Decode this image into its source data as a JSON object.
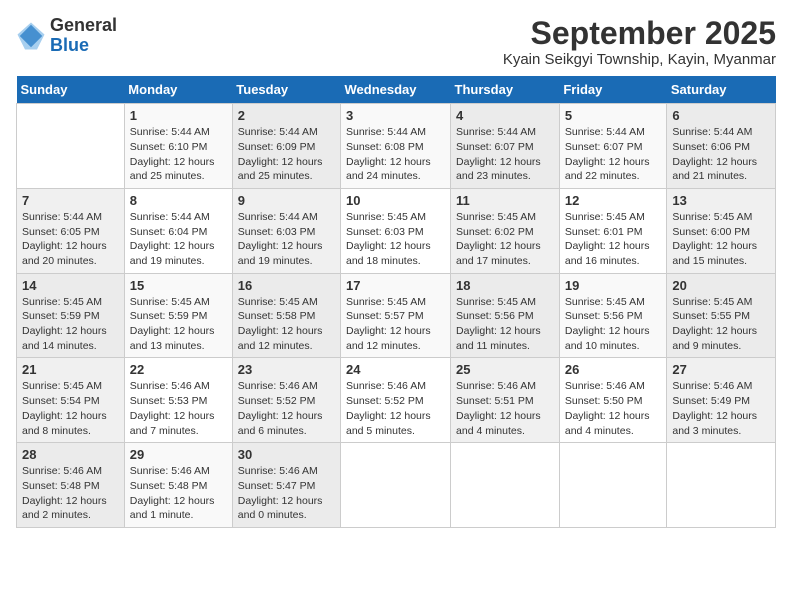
{
  "header": {
    "logo_general": "General",
    "logo_blue": "Blue",
    "month_title": "September 2025",
    "subtitle": "Kyain Seikgyi Township, Kayin, Myanmar"
  },
  "days_of_week": [
    "Sunday",
    "Monday",
    "Tuesday",
    "Wednesday",
    "Thursday",
    "Friday",
    "Saturday"
  ],
  "weeks": [
    [
      {
        "day": "",
        "sunrise": "",
        "sunset": "",
        "daylight": ""
      },
      {
        "day": "1",
        "sunrise": "Sunrise: 5:44 AM",
        "sunset": "Sunset: 6:10 PM",
        "daylight": "Daylight: 12 hours and 25 minutes."
      },
      {
        "day": "2",
        "sunrise": "Sunrise: 5:44 AM",
        "sunset": "Sunset: 6:09 PM",
        "daylight": "Daylight: 12 hours and 25 minutes."
      },
      {
        "day": "3",
        "sunrise": "Sunrise: 5:44 AM",
        "sunset": "Sunset: 6:08 PM",
        "daylight": "Daylight: 12 hours and 24 minutes."
      },
      {
        "day": "4",
        "sunrise": "Sunrise: 5:44 AM",
        "sunset": "Sunset: 6:07 PM",
        "daylight": "Daylight: 12 hours and 23 minutes."
      },
      {
        "day": "5",
        "sunrise": "Sunrise: 5:44 AM",
        "sunset": "Sunset: 6:07 PM",
        "daylight": "Daylight: 12 hours and 22 minutes."
      },
      {
        "day": "6",
        "sunrise": "Sunrise: 5:44 AM",
        "sunset": "Sunset: 6:06 PM",
        "daylight": "Daylight: 12 hours and 21 minutes."
      }
    ],
    [
      {
        "day": "7",
        "sunrise": "Sunrise: 5:44 AM",
        "sunset": "Sunset: 6:05 PM",
        "daylight": "Daylight: 12 hours and 20 minutes."
      },
      {
        "day": "8",
        "sunrise": "Sunrise: 5:44 AM",
        "sunset": "Sunset: 6:04 PM",
        "daylight": "Daylight: 12 hours and 19 minutes."
      },
      {
        "day": "9",
        "sunrise": "Sunrise: 5:44 AM",
        "sunset": "Sunset: 6:03 PM",
        "daylight": "Daylight: 12 hours and 19 minutes."
      },
      {
        "day": "10",
        "sunrise": "Sunrise: 5:45 AM",
        "sunset": "Sunset: 6:03 PM",
        "daylight": "Daylight: 12 hours and 18 minutes."
      },
      {
        "day": "11",
        "sunrise": "Sunrise: 5:45 AM",
        "sunset": "Sunset: 6:02 PM",
        "daylight": "Daylight: 12 hours and 17 minutes."
      },
      {
        "day": "12",
        "sunrise": "Sunrise: 5:45 AM",
        "sunset": "Sunset: 6:01 PM",
        "daylight": "Daylight: 12 hours and 16 minutes."
      },
      {
        "day": "13",
        "sunrise": "Sunrise: 5:45 AM",
        "sunset": "Sunset: 6:00 PM",
        "daylight": "Daylight: 12 hours and 15 minutes."
      }
    ],
    [
      {
        "day": "14",
        "sunrise": "Sunrise: 5:45 AM",
        "sunset": "Sunset: 5:59 PM",
        "daylight": "Daylight: 12 hours and 14 minutes."
      },
      {
        "day": "15",
        "sunrise": "Sunrise: 5:45 AM",
        "sunset": "Sunset: 5:59 PM",
        "daylight": "Daylight: 12 hours and 13 minutes."
      },
      {
        "day": "16",
        "sunrise": "Sunrise: 5:45 AM",
        "sunset": "Sunset: 5:58 PM",
        "daylight": "Daylight: 12 hours and 12 minutes."
      },
      {
        "day": "17",
        "sunrise": "Sunrise: 5:45 AM",
        "sunset": "Sunset: 5:57 PM",
        "daylight": "Daylight: 12 hours and 12 minutes."
      },
      {
        "day": "18",
        "sunrise": "Sunrise: 5:45 AM",
        "sunset": "Sunset: 5:56 PM",
        "daylight": "Daylight: 12 hours and 11 minutes."
      },
      {
        "day": "19",
        "sunrise": "Sunrise: 5:45 AM",
        "sunset": "Sunset: 5:56 PM",
        "daylight": "Daylight: 12 hours and 10 minutes."
      },
      {
        "day": "20",
        "sunrise": "Sunrise: 5:45 AM",
        "sunset": "Sunset: 5:55 PM",
        "daylight": "Daylight: 12 hours and 9 minutes."
      }
    ],
    [
      {
        "day": "21",
        "sunrise": "Sunrise: 5:45 AM",
        "sunset": "Sunset: 5:54 PM",
        "daylight": "Daylight: 12 hours and 8 minutes."
      },
      {
        "day": "22",
        "sunrise": "Sunrise: 5:46 AM",
        "sunset": "Sunset: 5:53 PM",
        "daylight": "Daylight: 12 hours and 7 minutes."
      },
      {
        "day": "23",
        "sunrise": "Sunrise: 5:46 AM",
        "sunset": "Sunset: 5:52 PM",
        "daylight": "Daylight: 12 hours and 6 minutes."
      },
      {
        "day": "24",
        "sunrise": "Sunrise: 5:46 AM",
        "sunset": "Sunset: 5:52 PM",
        "daylight": "Daylight: 12 hours and 5 minutes."
      },
      {
        "day": "25",
        "sunrise": "Sunrise: 5:46 AM",
        "sunset": "Sunset: 5:51 PM",
        "daylight": "Daylight: 12 hours and 4 minutes."
      },
      {
        "day": "26",
        "sunrise": "Sunrise: 5:46 AM",
        "sunset": "Sunset: 5:50 PM",
        "daylight": "Daylight: 12 hours and 4 minutes."
      },
      {
        "day": "27",
        "sunrise": "Sunrise: 5:46 AM",
        "sunset": "Sunset: 5:49 PM",
        "daylight": "Daylight: 12 hours and 3 minutes."
      }
    ],
    [
      {
        "day": "28",
        "sunrise": "Sunrise: 5:46 AM",
        "sunset": "Sunset: 5:48 PM",
        "daylight": "Daylight: 12 hours and 2 minutes."
      },
      {
        "day": "29",
        "sunrise": "Sunrise: 5:46 AM",
        "sunset": "Sunset: 5:48 PM",
        "daylight": "Daylight: 12 hours and 1 minute."
      },
      {
        "day": "30",
        "sunrise": "Sunrise: 5:46 AM",
        "sunset": "Sunset: 5:47 PM",
        "daylight": "Daylight: 12 hours and 0 minutes."
      },
      {
        "day": "",
        "sunrise": "",
        "sunset": "",
        "daylight": ""
      },
      {
        "day": "",
        "sunrise": "",
        "sunset": "",
        "daylight": ""
      },
      {
        "day": "",
        "sunrise": "",
        "sunset": "",
        "daylight": ""
      },
      {
        "day": "",
        "sunrise": "",
        "sunset": "",
        "daylight": ""
      }
    ]
  ]
}
